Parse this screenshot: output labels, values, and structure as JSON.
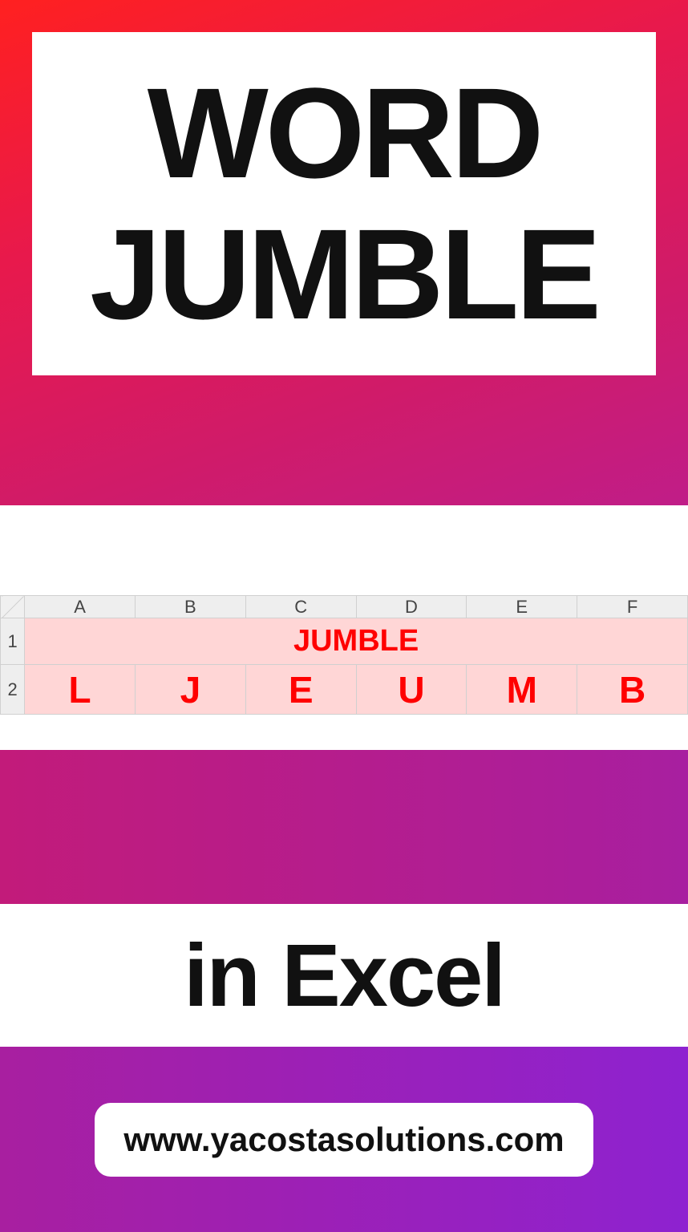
{
  "title": {
    "line1": "WORD",
    "line2": "JUMBLE"
  },
  "excel": {
    "columns": [
      "A",
      "B",
      "C",
      "D",
      "E",
      "F"
    ],
    "row_labels": [
      "1",
      "2"
    ],
    "merged_text": "JUMBLE",
    "letters": [
      "L",
      "J",
      "E",
      "U",
      "M",
      "B"
    ]
  },
  "subtitle": "in Excel",
  "url": "www.yacostasolutions.com"
}
